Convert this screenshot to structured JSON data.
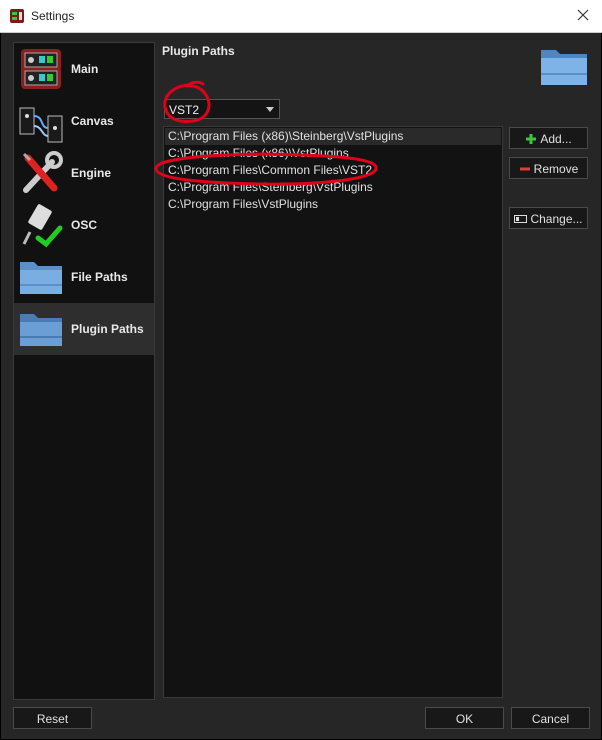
{
  "window": {
    "title": "Settings"
  },
  "sidebar": {
    "items": [
      {
        "label": "Main",
        "icon": "patch-modules-icon",
        "selected": false
      },
      {
        "label": "Canvas",
        "icon": "patch-cables-icon",
        "selected": false
      },
      {
        "label": "Engine",
        "icon": "wrench-screwdriver-icon",
        "selected": false
      },
      {
        "label": "OSC",
        "icon": "network-plug-icon",
        "selected": false
      },
      {
        "label": "File Paths",
        "icon": "folder-icon",
        "selected": false
      },
      {
        "label": "Plugin Paths",
        "icon": "folder-icon",
        "selected": true
      }
    ]
  },
  "main": {
    "section_title": "Plugin Paths",
    "plugin_type": {
      "selected": "VST2"
    },
    "paths": [
      "C:\\Program Files (x86)\\Steinberg\\VstPlugins",
      "C:\\Program Files (x86)\\VstPlugins",
      "C:\\Program Files\\Common Files\\VST2",
      "C:\\Program Files\\Steinberg\\VstPlugins",
      "C:\\Program Files\\VstPlugins"
    ],
    "selected_index": 0,
    "buttons": {
      "add": "Add...",
      "remove": "Remove",
      "change": "Change..."
    }
  },
  "footer": {
    "reset": "Reset",
    "ok": "OK",
    "cancel": "Cancel"
  },
  "colors": {
    "annotation": "#e0001a",
    "background": "#262626",
    "list_bg": "#121212",
    "add_green": "#3cc63c",
    "remove_red": "#e23b3b"
  }
}
